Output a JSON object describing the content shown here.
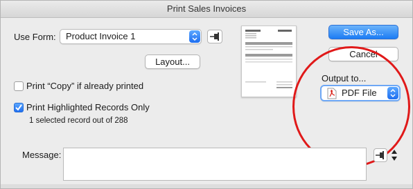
{
  "window": {
    "title": "Print Sales Invoices"
  },
  "form": {
    "use_form_label": "Use Form:",
    "selected_form": "Product Invoice 1",
    "layout_button": "Layout..."
  },
  "options": {
    "print_copy_label": "Print “Copy” if already printed",
    "print_copy_checked": false,
    "print_highlighted_label": "Print Highlighted Records Only",
    "print_highlighted_checked": true,
    "selection_info": "1 selected record out of 288"
  },
  "actions": {
    "save_as": "Save As...",
    "cancel": "Cancel"
  },
  "output": {
    "label": "Output to...",
    "selected": "PDF File"
  },
  "message": {
    "label": "Message:",
    "value": ""
  },
  "colors": {
    "accent": "#1e6ef0",
    "annotation": "#e01919",
    "pdf_icon": "#d9251c"
  }
}
